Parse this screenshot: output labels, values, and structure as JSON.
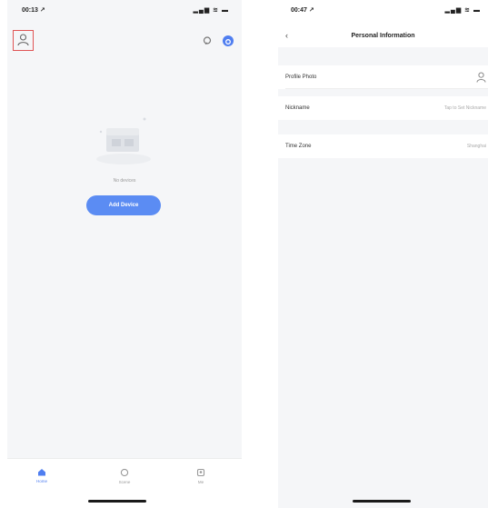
{
  "left": {
    "status": {
      "time": "00:13 ↗",
      "indicators": "▂▄▆ ≋ ▬"
    },
    "empty_text": "No devices",
    "add_button": "Add Device",
    "tabs": [
      {
        "label": "Home",
        "icon": "home-icon",
        "active": true
      },
      {
        "label": "Scene",
        "icon": "scene-icon",
        "active": false
      },
      {
        "label": "Me",
        "icon": "me-icon",
        "active": false
      }
    ],
    "accent": "#4f7ef0"
  },
  "right": {
    "status": {
      "time": "00:47 ↗",
      "indicators": "▂▄▆ ≋ ▬"
    },
    "nav": {
      "back": "‹",
      "title": "Personal Information"
    },
    "rows": [
      {
        "label": "Profile Photo",
        "value": ""
      },
      {
        "label": "Nickname",
        "value": "Tap to Set Nickname"
      },
      {
        "label": "Time Zone",
        "value": "Shanghai"
      }
    ]
  }
}
